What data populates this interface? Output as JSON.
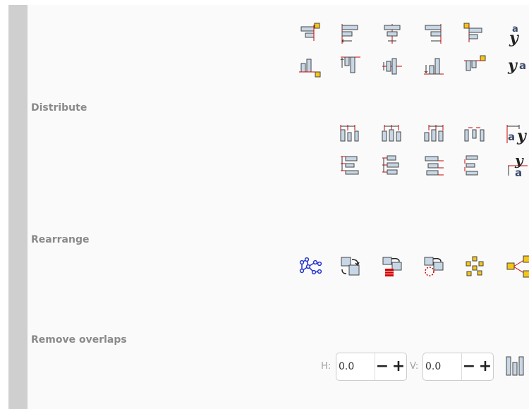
{
  "sections": {
    "distribute": "Distribute",
    "rearrange": "Rearrange",
    "remove_overlaps": "Remove overlaps"
  },
  "overlaps": {
    "h_label": "H:",
    "h_value": "0.0",
    "v_label": "V:",
    "v_value": "0.0",
    "minus": "−",
    "plus": "+"
  },
  "icon_text": {
    "a": "a",
    "y": "y"
  },
  "colors": {
    "panel": "#fafafa",
    "strip": "#cfcfcf",
    "guide_red": "#d40000",
    "box_fill": "#c8d7e6",
    "box_stroke": "#444444",
    "yellow": "#f5c518",
    "blue_node": "#2233cc"
  }
}
